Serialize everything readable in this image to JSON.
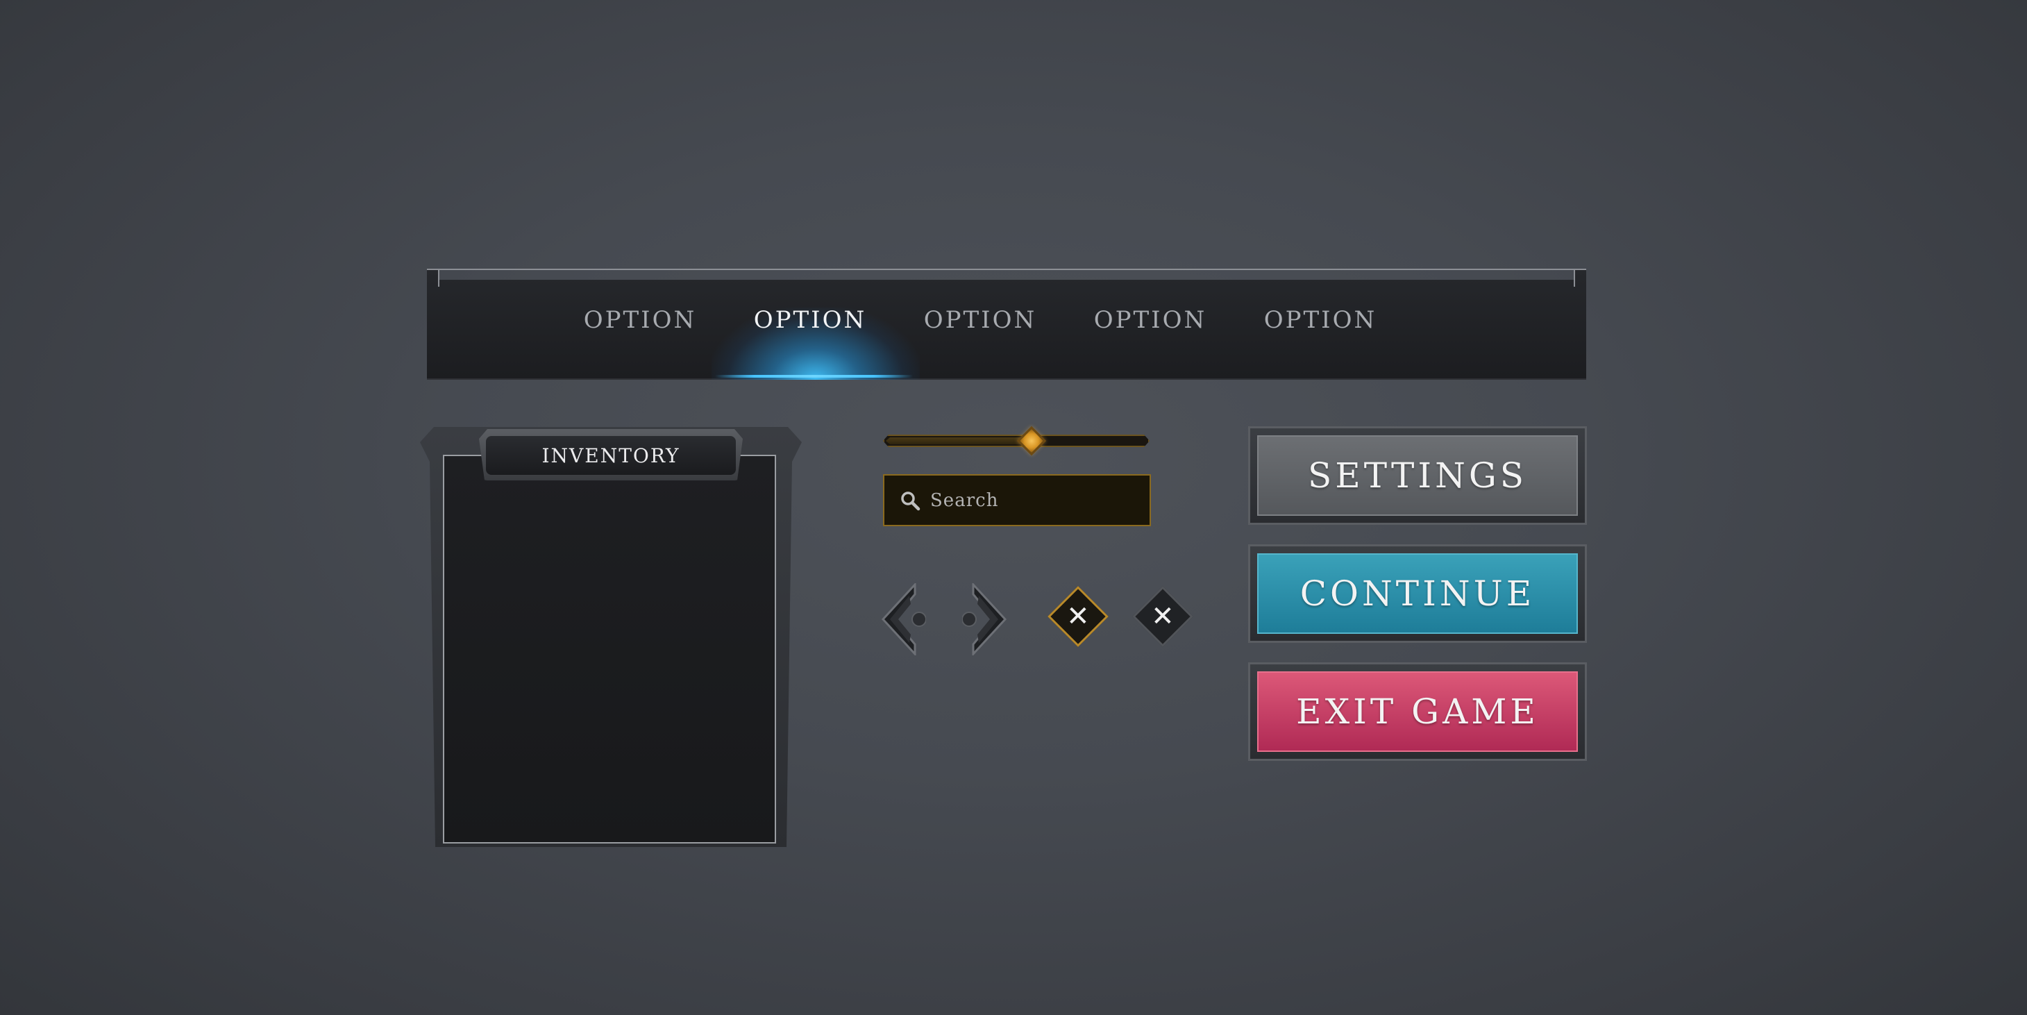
{
  "navbar": {
    "tabs": [
      {
        "label": "OPTION",
        "active": false
      },
      {
        "label": "OPTION",
        "active": true
      },
      {
        "label": "OPTION",
        "active": false
      },
      {
        "label": "OPTION",
        "active": false
      },
      {
        "label": "OPTION",
        "active": false
      }
    ],
    "accent_color": "#47c4ff"
  },
  "inventory": {
    "title": "INVENTORY"
  },
  "slider": {
    "value_fraction": 0.55,
    "thumb_color": "#d99625"
  },
  "search": {
    "placeholder": "Search",
    "icon": "search-icon"
  },
  "controls": {
    "prev_icon": "chevron-left-icon",
    "next_icon": "chevron-right-icon",
    "close_gold_icon": "close-icon",
    "close_dark_icon": "close-icon",
    "close_glyph": "✕"
  },
  "menu": {
    "settings_label": "SETTINGS",
    "continue_label": "CONTINUE",
    "exit_label": "EXIT GAME",
    "settings_color": "#606367",
    "continue_color": "#2a90ab",
    "exit_color": "#c83f66"
  }
}
